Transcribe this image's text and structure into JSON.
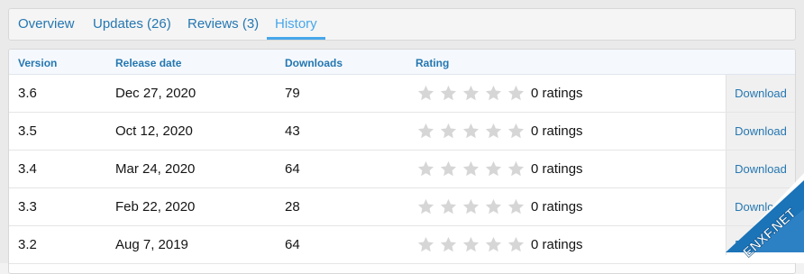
{
  "tabs": [
    {
      "label": "Overview",
      "active": false
    },
    {
      "label": "Updates (26)",
      "active": false
    },
    {
      "label": "Reviews (3)",
      "active": false
    },
    {
      "label": "History",
      "active": true
    }
  ],
  "table": {
    "headers": {
      "version": "Version",
      "release_date": "Release date",
      "downloads": "Downloads",
      "rating": "Rating"
    },
    "rows": [
      {
        "version": "3.6",
        "date": "Dec 27, 2020",
        "downloads": "79",
        "stars": 0,
        "ratings": "0 ratings",
        "action": "Download"
      },
      {
        "version": "3.5",
        "date": "Oct 12, 2020",
        "downloads": "43",
        "stars": 0,
        "ratings": "0 ratings",
        "action": "Download"
      },
      {
        "version": "3.4",
        "date": "Mar 24, 2020",
        "downloads": "64",
        "stars": 0,
        "ratings": "0 ratings",
        "action": "Download"
      },
      {
        "version": "3.3",
        "date": "Feb 22, 2020",
        "downloads": "28",
        "stars": 0,
        "ratings": "0 ratings",
        "action": "Download"
      },
      {
        "version": "3.2",
        "date": "Aug 7, 2019",
        "downloads": "64",
        "stars": 0,
        "ratings": "0 ratings",
        "action": "Download"
      }
    ]
  },
  "watermark": {
    "text": "ENXF.NET"
  },
  "colors": {
    "link": "#2577b1",
    "active_tab": "#47a7eb",
    "star_empty": "#d6d6d6",
    "watermark_blue": "#1b73b8"
  }
}
